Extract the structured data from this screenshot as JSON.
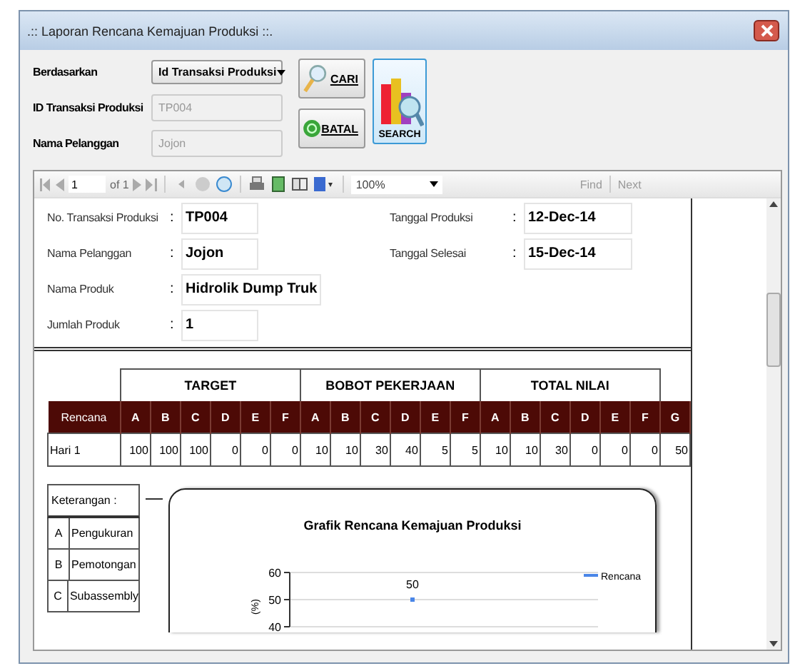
{
  "window": {
    "title": ".:: Laporan Rencana Kemajuan Produksi ::."
  },
  "form": {
    "fields": [
      {
        "label": "Berdasarkan",
        "kind": "select",
        "value": "Id Transaksi Produksi",
        "disabled": false
      },
      {
        "label": "ID Transaksi Produksi",
        "kind": "text",
        "value": "TP004",
        "disabled": true
      },
      {
        "label": "Nama Pelanggan",
        "kind": "text",
        "value": "Jojon",
        "disabled": true
      }
    ],
    "buttons": [
      {
        "label": "CARI",
        "kind": "search"
      },
      {
        "label": "BATAL",
        "kind": "cancel"
      }
    ],
    "big_button": {
      "label": "SEARCH"
    }
  },
  "toolbar": {
    "page": "1",
    "page_count": "of 1",
    "zoom": "100%",
    "find": "Find",
    "next": "Next"
  },
  "report": {
    "info_left": [
      {
        "label": "No. Transaksi Produksi",
        "colon": ":",
        "value": "TP004"
      },
      {
        "label": "Nama Pelanggan",
        "colon": ":",
        "value": "Jojon"
      },
      {
        "label": "Nama Produk",
        "colon": ":",
        "value": "Hidrolik Dump Truk"
      },
      {
        "label": "Jumlah Produk",
        "colon": ":",
        "value": "1"
      }
    ],
    "info_right": [
      {
        "label": "Tanggal Produksi",
        "colon": ":",
        "value": "12-Dec-14"
      },
      {
        "label": "Tanggal Selesai",
        "colon": ":",
        "value": "15-Dec-14"
      }
    ],
    "table": {
      "groups": [
        "TARGET",
        "BOBOT PEKERJAAN",
        "TOTAL NILAI"
      ],
      "row_header": "Rencana",
      "columns": [
        "A",
        "B",
        "C",
        "D",
        "E",
        "F",
        "A",
        "B",
        "C",
        "D",
        "E",
        "F",
        "A",
        "B",
        "C",
        "D",
        "E",
        "F",
        "G"
      ],
      "rows": [
        {
          "label": "Hari 1",
          "cells": [
            "100",
            "100",
            "100",
            "0",
            "0",
            "0",
            "10",
            "10",
            "30",
            "40",
            "5",
            "5",
            "10",
            "10",
            "30",
            "0",
            "0",
            "0",
            "50"
          ]
        }
      ]
    },
    "legend": {
      "title": "Keterangan :",
      "items": [
        {
          "code": "A",
          "name": "Pengukuran"
        },
        {
          "code": "B",
          "name": "Pemotongan"
        },
        {
          "code": "C",
          "name": "Subassembly"
        }
      ]
    },
    "chart": {
      "chart_data": {
        "type": "line",
        "title": "Grafik Rencana Kemajuan Produksi",
        "ylabel": "(%)",
        "ylim": [
          40,
          60
        ],
        "yticks": [
          40,
          50,
          60
        ],
        "series": [
          {
            "name": "Rencana",
            "color": "#4a86e8",
            "marker": "square",
            "values": [
              50
            ]
          }
        ],
        "data_labels": true
      }
    }
  }
}
